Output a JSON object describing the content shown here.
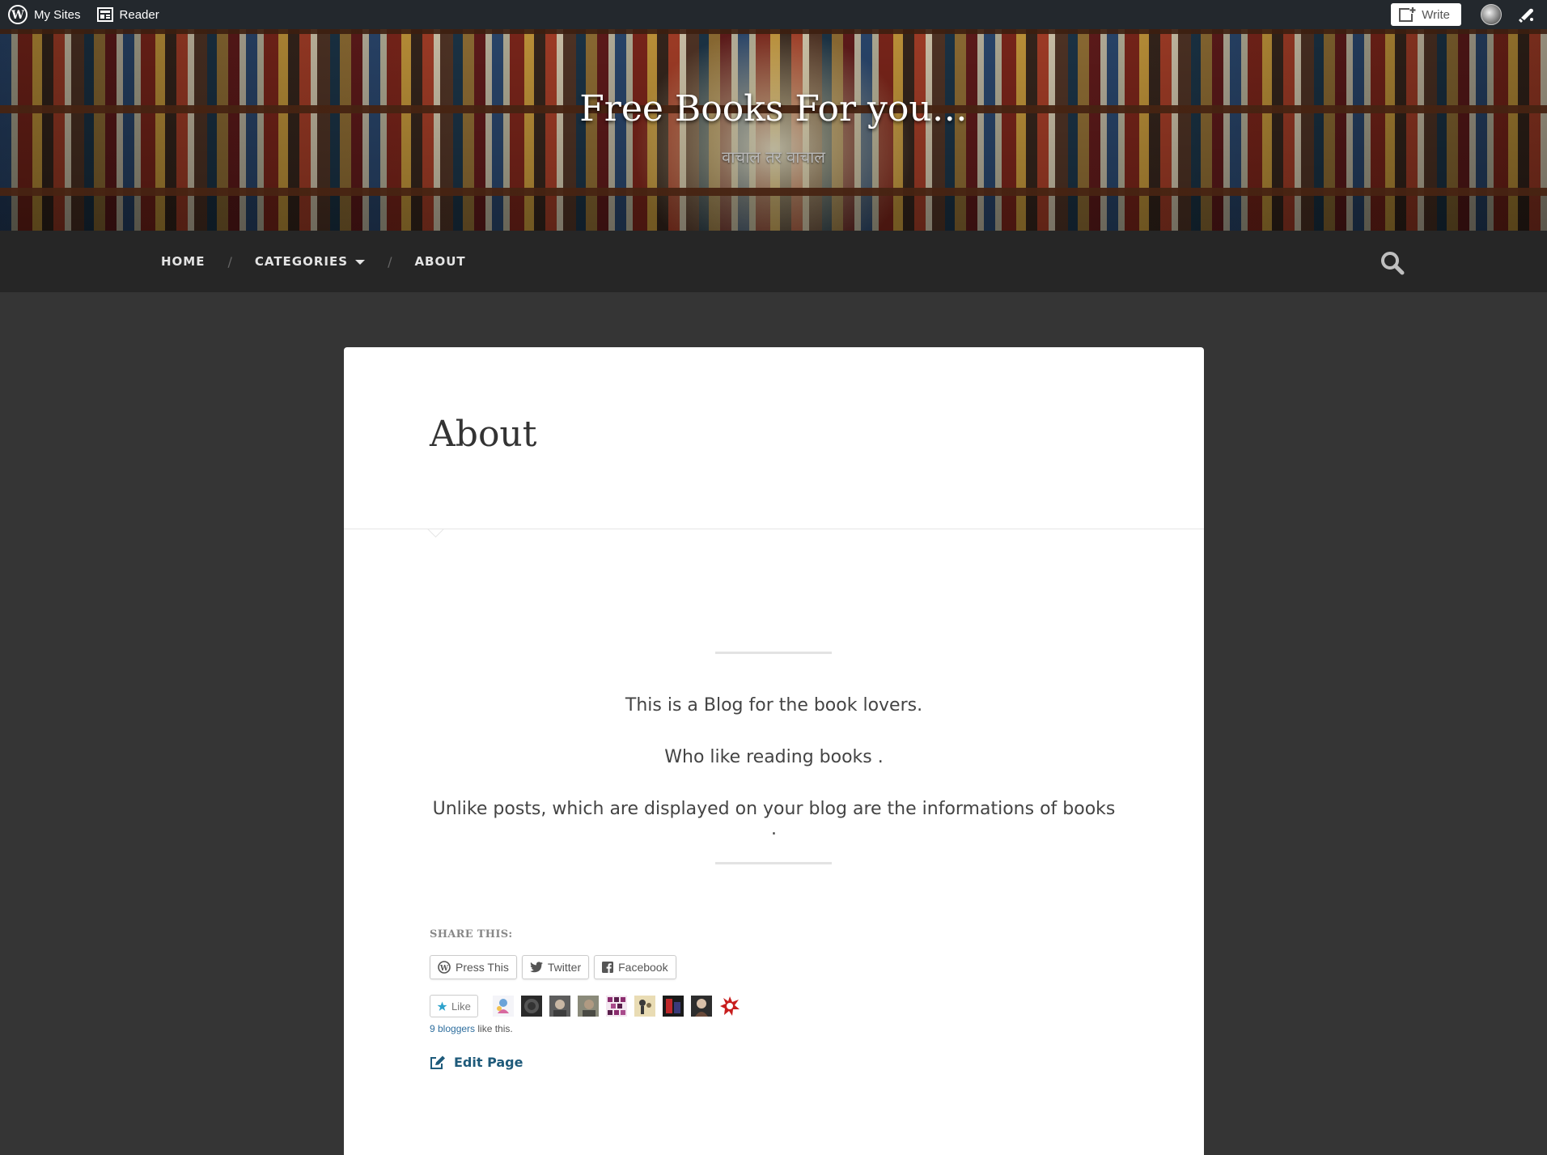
{
  "admin_bar": {
    "my_sites_label": "My Sites",
    "reader_label": "Reader",
    "write_label": "Write"
  },
  "header": {
    "site_title": "Free Books For you…",
    "tagline": "वाचाल तर वाचाल"
  },
  "nav": {
    "items": [
      {
        "label": "HOME"
      },
      {
        "label": "CATEGORIES",
        "has_dropdown": true
      },
      {
        "label": "ABOUT"
      }
    ],
    "separator": "/"
  },
  "page": {
    "title": "About",
    "paragraphs": [
      "This is a Blog for the book lovers.",
      "Who like reading books .",
      "Unlike posts, which are displayed on your blog are the informations of books ."
    ]
  },
  "share": {
    "heading": "SHARE THIS:",
    "buttons": [
      {
        "label": "Press This",
        "icon": "wordpress-icon"
      },
      {
        "label": "Twitter",
        "icon": "twitter-icon"
      },
      {
        "label": "Facebook",
        "icon": "facebook-icon"
      }
    ]
  },
  "likes": {
    "like_label": "Like",
    "bloggers_link": "9 bloggers",
    "suffix": " like this."
  },
  "edit": {
    "label": "Edit Page"
  },
  "colors": {
    "admin_bar": "#23282d",
    "nav_bg": "#262626",
    "page_bg": "#353535",
    "link": "#1e5a7a"
  }
}
